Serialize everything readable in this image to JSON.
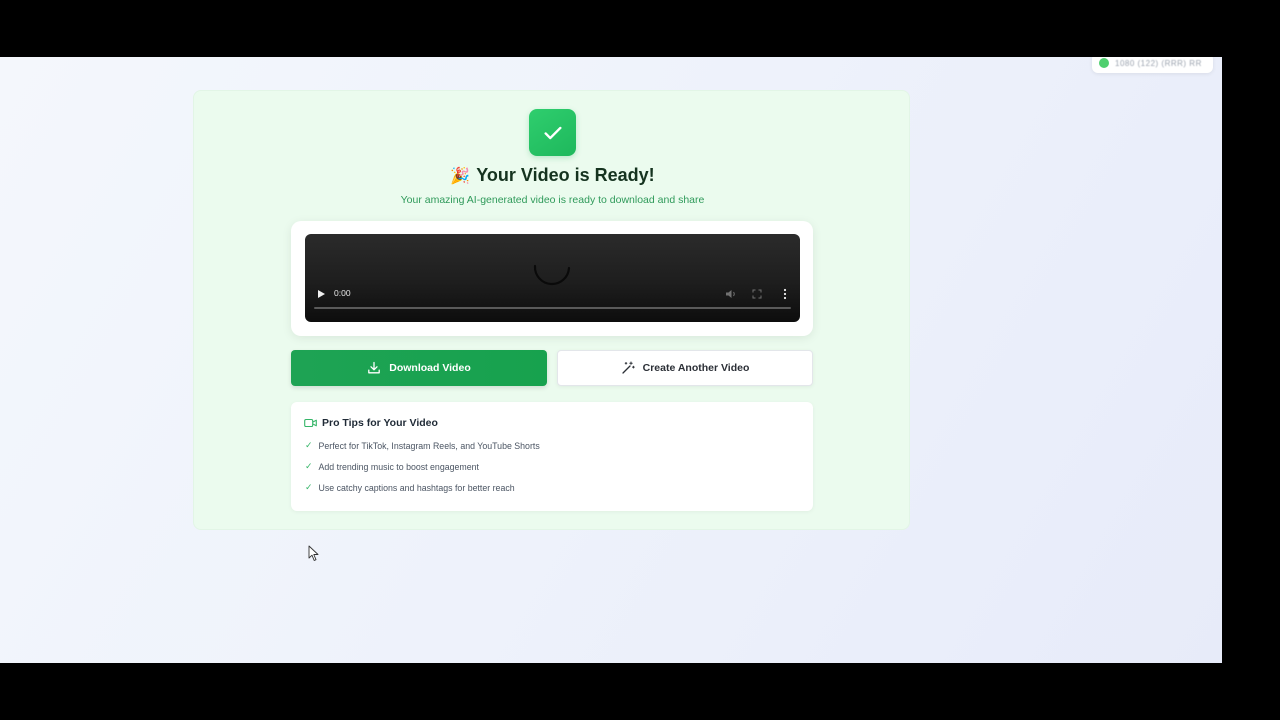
{
  "status": {
    "text": "1080 (122) (RRR) RR"
  },
  "success": {
    "title": "Your Video is Ready!",
    "title_emoji": "🎉",
    "subtitle": "Your amazing AI-generated video is ready to download and share"
  },
  "video": {
    "time": "0:00"
  },
  "actions": {
    "download_label": "Download Video",
    "create_label": "Create Another Video"
  },
  "tips": {
    "title": "Pro Tips for Your Video",
    "items": [
      "Perfect for TikTok, Instagram Reels, and YouTube Shorts",
      "Add trending music to boost engagement",
      "Use catchy captions and hashtags for better reach"
    ]
  },
  "colors": {
    "accent": "#1ea354",
    "card_bg": "#ebfbee"
  }
}
